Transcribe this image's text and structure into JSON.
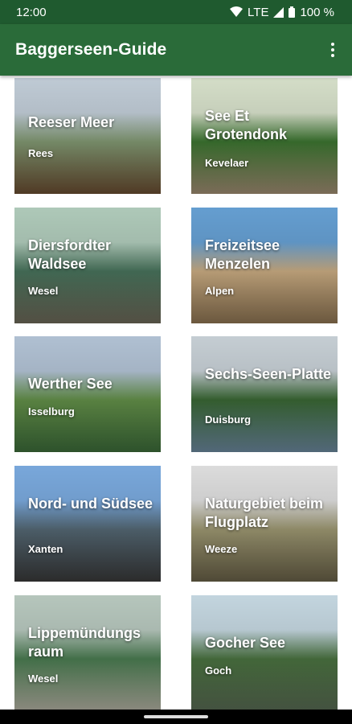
{
  "status_bar": {
    "time": "12:00",
    "network": "LTE",
    "battery": "100 %"
  },
  "app_bar": {
    "title": "Baggerseen-Guide",
    "menu_icon": "more-vert-icon"
  },
  "lakes": [
    {
      "name": "Reeser Meer",
      "town": "Rees",
      "palette": [
        "#c9d5e0",
        "#8aa37a",
        "#6b4e32"
      ]
    },
    {
      "name": "See Et Grotendonk",
      "town": "Kevelaer",
      "palette": [
        "#dfe9d2",
        "#3f7c33",
        "#a38f74"
      ]
    },
    {
      "name": "Diersfordter Waldsee",
      "town": "Wesel",
      "palette": [
        "#b7d3c2",
        "#4d7b62",
        "#6f6a5a"
      ]
    },
    {
      "name": "Freizeitsee Menzelen",
      "town": "Alpen",
      "palette": [
        "#6aa6db",
        "#d9b98c",
        "#8f7553"
      ]
    },
    {
      "name": "Werther See",
      "town": "Isselburg",
      "palette": [
        "#b9cadd",
        "#6a9a4e",
        "#3d6d3a"
      ]
    },
    {
      "name": "Sechs-Seen-Platte",
      "town": "Duisburg",
      "palette": [
        "#cfd8de",
        "#3d6e37",
        "#6d8aa0"
      ]
    },
    {
      "name": "Nord- und Südsee",
      "town": "Xanten",
      "palette": [
        "#7fb0e6",
        "#5a6f7c",
        "#3a3a3a"
      ]
    },
    {
      "name": "Naturgebiet beim Flugplatz",
      "town": "Weeze",
      "palette": [
        "#e7e7e7",
        "#a8a27a",
        "#6a6248"
      ]
    },
    {
      "name": "Lippemündungs raum",
      "town": "Wesel",
      "palette": [
        "#bfd0c6",
        "#4f8456",
        "#b9b6a8"
      ]
    },
    {
      "name": "Gocher See",
      "town": "Goch",
      "palette": [
        "#cde0ea",
        "#4f7a44",
        "#5a6d55"
      ]
    }
  ]
}
